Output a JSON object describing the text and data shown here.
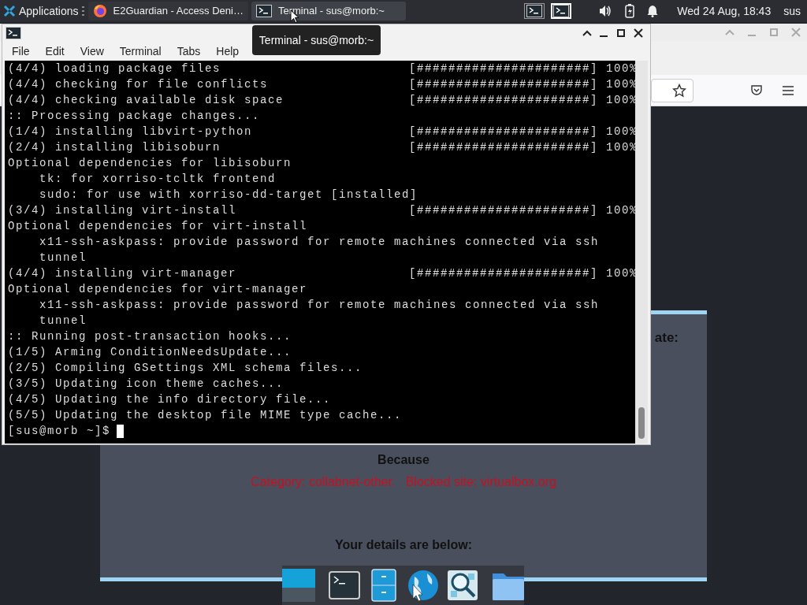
{
  "panel": {
    "applications_label": "Applications",
    "tasks": [
      {
        "kind": "browser",
        "title": "E2Guardian - Access Deni…",
        "selected": false
      },
      {
        "kind": "terminal",
        "title": "Terminal - sus@morb:~",
        "selected": true
      }
    ],
    "workspaces": [
      {
        "selected": false
      },
      {
        "selected": true
      }
    ],
    "clock": "Wed 24 Aug, 18:43",
    "user": "sus"
  },
  "tooltip": "Terminal - sus@morb:~",
  "terminal": {
    "menu": [
      "File",
      "Edit",
      "View",
      "Terminal",
      "Tabs",
      "Help"
    ],
    "lines": [
      {
        "text": "(4/4) loading package files",
        "progress": "[######################] 100%"
      },
      {
        "text": "(4/4) checking for file conflicts",
        "progress": "[######################] 100%"
      },
      {
        "text": "(4/4) checking available disk space",
        "progress": "[######################] 100%"
      },
      {
        "text": ":: Processing package changes..."
      },
      {
        "text": "(1/4) installing libvirt-python",
        "progress": "[######################] 100%"
      },
      {
        "text": "(2/4) installing libisoburn",
        "progress": "[######################] 100%"
      },
      {
        "text": "Optional dependencies for libisoburn"
      },
      {
        "text": "    tk: for xorriso-tcltk frontend"
      },
      {
        "text": "    sudo: for use with xorriso-dd-target [installed]"
      },
      {
        "text": "(3/4) installing virt-install",
        "progress": "[######################] 100%"
      },
      {
        "text": "Optional dependencies for virt-install"
      },
      {
        "text": "    x11-ssh-askpass: provide password for remote machines connected via ssh"
      },
      {
        "text": "    tunnel"
      },
      {
        "text": "(4/4) installing virt-manager",
        "progress": "[######################] 100%"
      },
      {
        "text": "Optional dependencies for virt-manager"
      },
      {
        "text": "    x11-ssh-askpass: provide password for remote machines connected via ssh"
      },
      {
        "text": "    tunnel"
      },
      {
        "text": ":: Running post-transaction hooks..."
      },
      {
        "text": "(1/5) Arming ConditionNeedsUpdate..."
      },
      {
        "text": "(2/5) Compiling GSettings XML schema files..."
      },
      {
        "text": "(3/5) Updating icon theme caches..."
      },
      {
        "text": "(4/5) Updating the info directory file..."
      },
      {
        "text": "(5/5) Updating the desktop file MIME type cache..."
      }
    ],
    "prompt": "[sus@morb ~]$"
  },
  "browser": {
    "page": {
      "heading_fragment": "ate:",
      "because": "Because",
      "reason": "Category: collabnet-other.   Blocked site: virtualbox.org",
      "details_heading": "Your details are below:"
    }
  },
  "dock": [
    {
      "kind": "desktop"
    },
    {
      "kind": "separator"
    },
    {
      "kind": "terminal"
    },
    {
      "kind": "cabinet"
    },
    {
      "kind": "globe"
    },
    {
      "kind": "search"
    },
    {
      "kind": "separator"
    },
    {
      "kind": "folder"
    }
  ]
}
